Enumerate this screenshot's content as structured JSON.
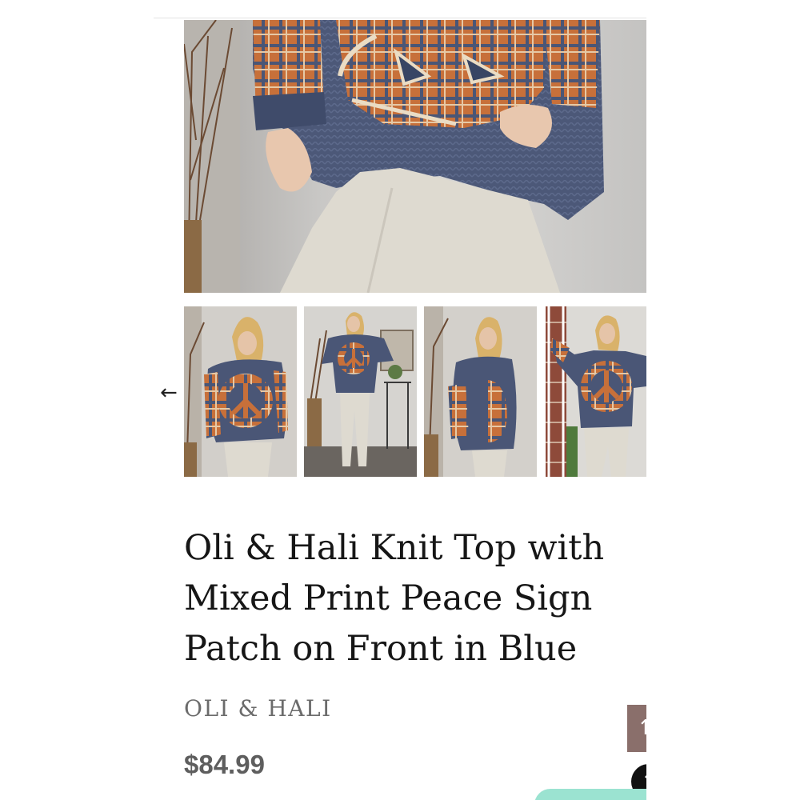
{
  "product": {
    "title": "Oli & Hali Knit Top with Mixed Print Peace Sign Patch on Front in Blue",
    "brand": "OLI & HALI",
    "price": "$84.99"
  },
  "gallery": {
    "prev_arrow": "←",
    "thumbnails": [
      {
        "label": "front view, peace sign patch"
      },
      {
        "label": "full-length view"
      },
      {
        "label": "side view"
      },
      {
        "label": "arms raised view"
      }
    ]
  },
  "scroll_top": {
    "glyph": "↑"
  },
  "chat": {
    "glyph": "↑"
  },
  "colors": {
    "sweater_blue": "#4a5676",
    "plaid_orange": "#c7703a",
    "pants": "#dedad0",
    "price_text": "#5e5e5e",
    "scroll_button": "#8a6f6b",
    "teal_button": "#9be3d1"
  }
}
